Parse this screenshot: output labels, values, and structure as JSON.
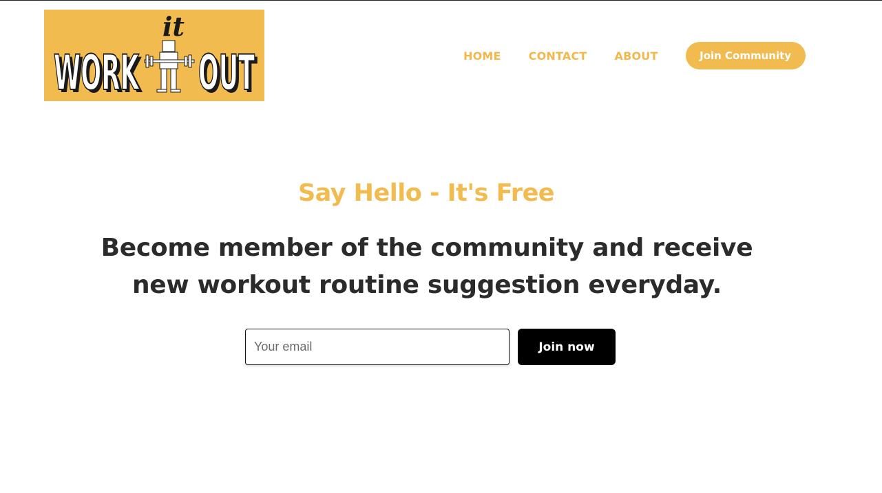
{
  "brand": {
    "logo_text_small": "it",
    "logo_text_left": "WORK",
    "logo_text_right": "OUT",
    "logo_bg": "#f2bb50"
  },
  "nav": {
    "items": [
      {
        "label": "HOME"
      },
      {
        "label": "CONTACT"
      },
      {
        "label": "ABOUT"
      }
    ],
    "cta_label": "Join Community"
  },
  "hero": {
    "tagline": "Say Hello - It's Free",
    "title": "Become member of the community and receive new workout routine suggestion everyday.",
    "email_placeholder": "Your email",
    "email_value": "",
    "submit_label": "Join now"
  },
  "colors": {
    "accent": "#f2bb50",
    "text_dark": "#2b2b2b",
    "button_dark": "#000000"
  }
}
